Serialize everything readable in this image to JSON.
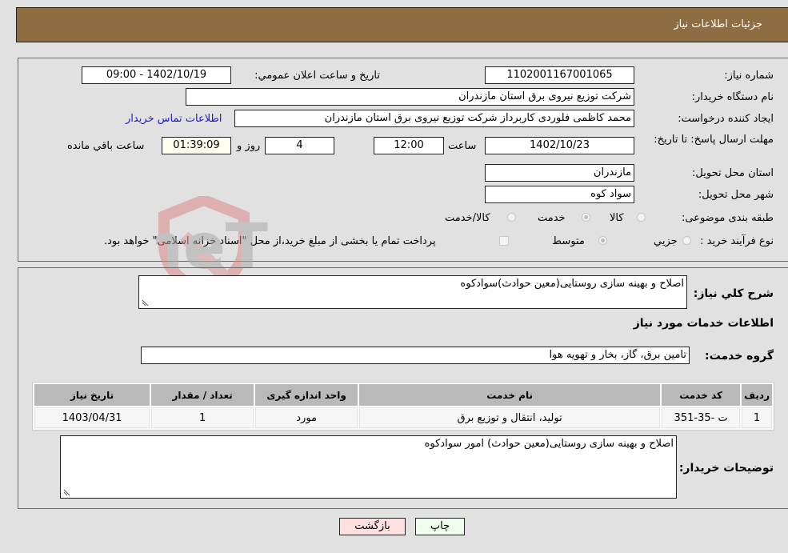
{
  "header": {
    "title": "جزئیات اطلاعات نیاز"
  },
  "form": {
    "need_number": {
      "label": "شماره نیاز:",
      "value": "1102001167001065"
    },
    "announce_datetime": {
      "label": "تاریخ و ساعت اعلان عمومي:",
      "value": "1402/10/19 - 09:00"
    },
    "buyer_org": {
      "label": "نام دستگاه خريدار:",
      "value": "شرکت توزیع نیروی برق استان مازندران"
    },
    "requester": {
      "label": "ایجاد کننده درخواست:",
      "value": "محمد کاظمی فلوردی کاربرداز شرکت توزیع نیروی برق استان مازندران",
      "contact_link": "اطلاعات تماس خریدار"
    },
    "deadline": {
      "label": "مهلت ارسال پاسخ: تا تاریخ:",
      "date": "1402/10/23",
      "time_label": "ساعت",
      "time": "12:00",
      "days": "4",
      "days_label": "روز و",
      "remaining": "01:39:09",
      "remaining_label": "ساعت باقي مانده"
    },
    "province": {
      "label": "استان محل تحویل:",
      "value": "مازندران"
    },
    "city": {
      "label": "شهر محل تحویل:",
      "value": "سواد کوه"
    },
    "category": {
      "label": "طبقه بندی موضوعی:",
      "options": [
        {
          "label": "کالا",
          "checked": false
        },
        {
          "label": "خدمت",
          "checked": true
        },
        {
          "label": "کالا/خدمت",
          "checked": false
        }
      ]
    },
    "purchase_type": {
      "label": "نوع فرآیند خرید :",
      "options": [
        {
          "label": "جزيي",
          "checked": false
        },
        {
          "label": "متوسط",
          "checked": true
        }
      ],
      "treasury_checkbox_label": "پرداخت تمام یا بخشی از مبلغ خرید،از محل \"اسناد خزانه اسلامی\" خواهد بود.",
      "treasury_checked": false
    }
  },
  "details": {
    "description_label": "شرح كلي نياز:",
    "description": "اصلاح و بهینه سازی روستایی(معین حوادث)سوادکوه",
    "services_heading": "اطلاعات خدمات مورد نياز",
    "service_group_label": "گروه خدمت:",
    "service_group": "تامین برق، گاز، بخار و تهویه هوا",
    "table": {
      "headers": [
        "رديف",
        "کد خدمت",
        "نام خدمت",
        "واحد اندازه گيری",
        "تعداد / مقدار",
        "تاريخ نياز"
      ],
      "rows": [
        [
          "1",
          "ت -35-351",
          "تولید، انتقال و توزیع برق",
          "مورد",
          "1",
          "1403/04/31"
        ]
      ]
    },
    "buyer_notes_label": "توضيحات خريدار:",
    "buyer_notes": "اصلاح و بهینه سازی روستایی(معین حوادث) امور سوادکوه"
  },
  "buttons": {
    "print": "چاپ",
    "back": "بازگشت"
  },
  "watermark": {
    "text": "AriaTender.neT"
  },
  "colors": {
    "header_bg": "#8e6d42",
    "print_bg": "#eeffee",
    "back_bg": "#ffe0e0",
    "link": "#1a1acc"
  }
}
